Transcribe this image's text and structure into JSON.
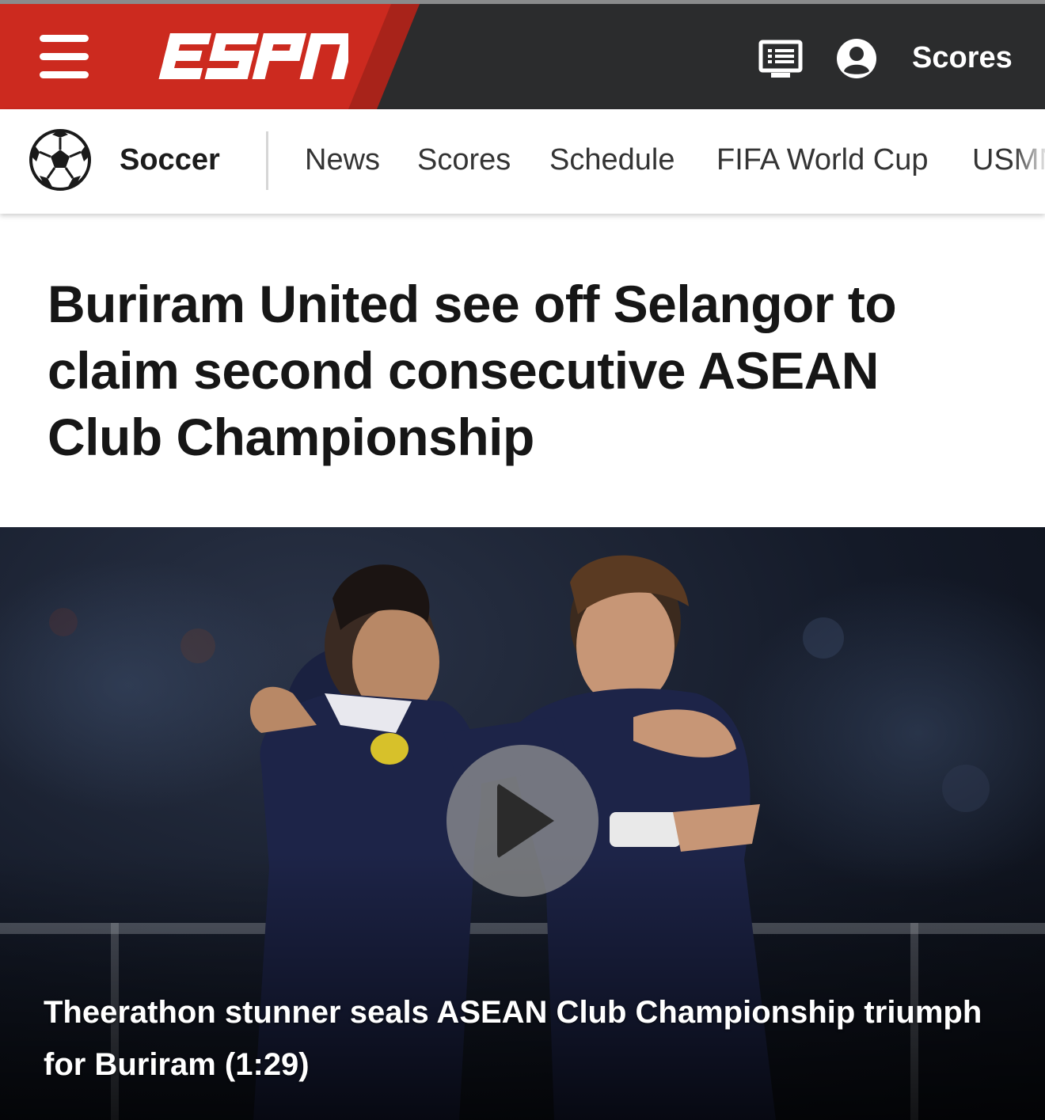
{
  "header": {
    "logo_text": "ESPN",
    "scores_label": "Scores",
    "icons": [
      "menu-icon",
      "tv-guide-icon",
      "user-account-icon"
    ]
  },
  "subnav": {
    "sport": "Soccer",
    "items": [
      {
        "label": "News"
      },
      {
        "label": "Scores"
      },
      {
        "label": "Schedule"
      },
      {
        "label": "FIFA World Cup"
      },
      {
        "label": "USMN"
      }
    ]
  },
  "article": {
    "headline": "Buriram United see off Selangor to claim second consecutive ASEAN Club Championship"
  },
  "video": {
    "caption": "Theerathon stunner seals ASEAN Club Championship triumph for Buriram (1:29)",
    "play_icon": "play-icon"
  },
  "colors": {
    "espn_red": "#cc2a1f",
    "header_dark": "#2b2c2d",
    "text_dark": "#161616"
  }
}
